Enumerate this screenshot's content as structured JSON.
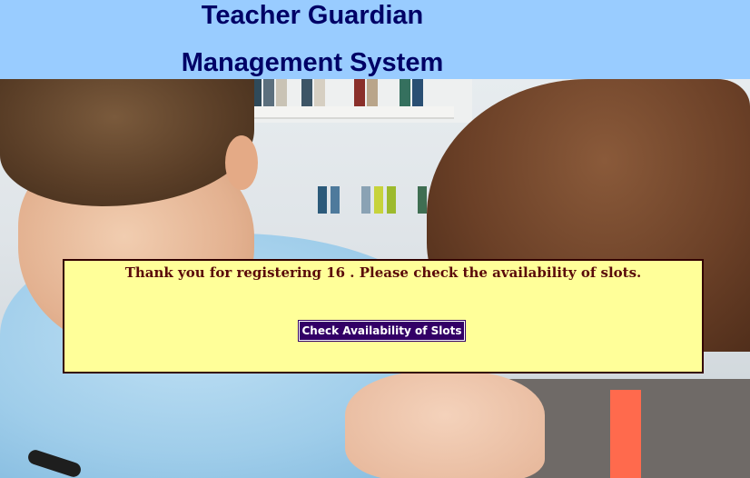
{
  "header": {
    "title_line1": "Teacher Guardian",
    "title_line2": "Management System"
  },
  "background": {
    "description_icon": "students-studying-photo"
  },
  "panel": {
    "message": "Thank you for registering 16 . Please check the availability of slots.",
    "button_label": "Check Availability of Slots"
  },
  "colors": {
    "header_bg": "#99ccff",
    "title_text": "#000066",
    "panel_bg": "#ffff99",
    "panel_border": "#330000",
    "message_text": "#5a0a0a",
    "button_bg": "#330066",
    "button_text": "#ffffff"
  }
}
